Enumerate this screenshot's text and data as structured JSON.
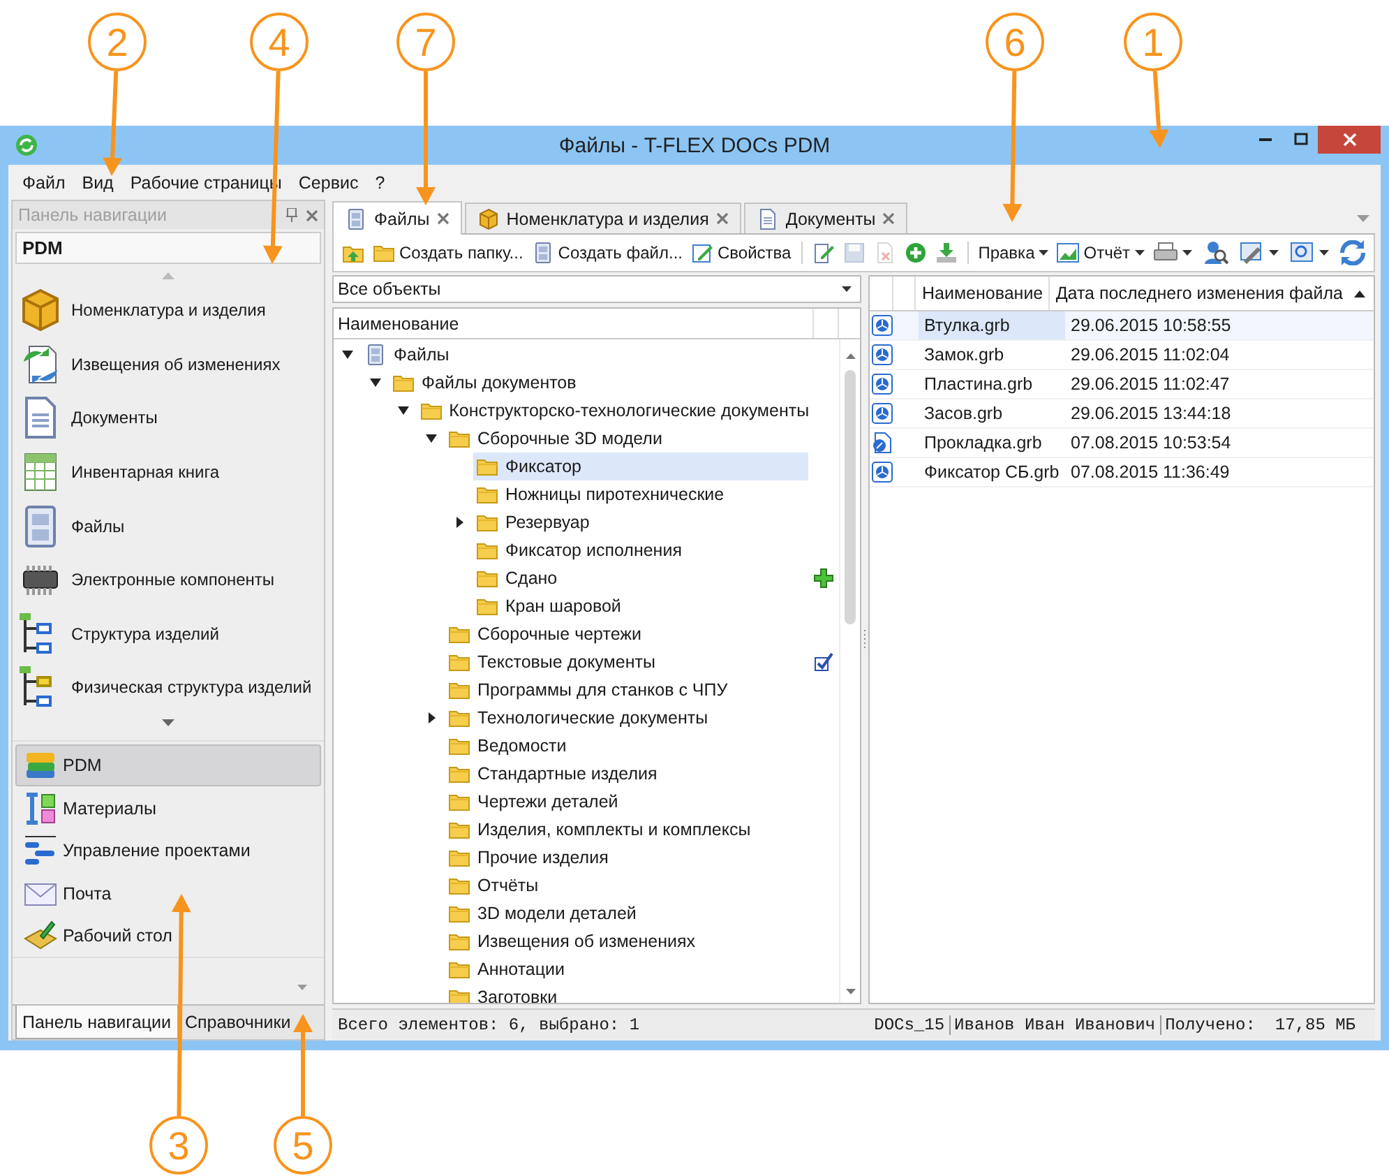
{
  "callouts": [
    {
      "number": "2"
    },
    {
      "number": "4"
    },
    {
      "number": "7"
    },
    {
      "number": "6"
    },
    {
      "number": "1"
    },
    {
      "number": "3"
    },
    {
      "number": "5"
    }
  ],
  "window": {
    "title": "Файлы - T-FLEX DOCs PDM"
  },
  "menu": [
    "Файл",
    "Вид",
    "Рабочие страницы",
    "Сервис",
    "?"
  ],
  "nav_panel": {
    "title": "Панель навигации",
    "section": "PDM",
    "items": [
      {
        "label": "Номенклатура и изделия"
      },
      {
        "label": "Извещения об изменениях"
      },
      {
        "label": "Документы"
      },
      {
        "label": "Инвентарная книга"
      },
      {
        "label": "Файлы"
      },
      {
        "label": "Электронные компоненты"
      },
      {
        "label": "Структура изделий"
      },
      {
        "label": "Физическая структура изделий"
      }
    ],
    "groups": [
      {
        "label": "PDM",
        "selected": true
      },
      {
        "label": "Материалы",
        "selected": false
      },
      {
        "label": "Управление проектами",
        "selected": false
      },
      {
        "label": "Почта",
        "selected": false
      },
      {
        "label": "Рабочий стол",
        "selected": false
      }
    ],
    "bottom_tabs": [
      {
        "label": "Панель навигации",
        "selected": true
      },
      {
        "label": "Справочники",
        "selected": false
      }
    ]
  },
  "tabs": [
    {
      "label": "Файлы",
      "selected": true
    },
    {
      "label": "Номенклатура и изделия",
      "selected": false
    },
    {
      "label": "Документы",
      "selected": false
    }
  ],
  "toolbar": {
    "left": [
      {
        "kind": "icon",
        "disabled": false
      },
      {
        "kind": "button",
        "label": "Создать папку..."
      },
      {
        "kind": "button",
        "label": "Создать файл..."
      },
      {
        "kind": "button",
        "label": "Свойства"
      },
      {
        "kind": "separator"
      },
      {
        "kind": "icon",
        "disabled": false
      },
      {
        "kind": "icon",
        "disabled": true
      },
      {
        "kind": "icon",
        "disabled": true
      },
      {
        "kind": "icon",
        "disabled": false
      },
      {
        "kind": "icon",
        "disabled": false
      },
      {
        "kind": "separator"
      },
      {
        "kind": "menu",
        "label": "Правка"
      },
      {
        "kind": "menu",
        "label": "Отчёт"
      }
    ],
    "right": [
      {
        "kind": "icon-menu"
      },
      {
        "kind": "icon"
      },
      {
        "kind": "icon-menu"
      },
      {
        "kind": "icon-menu"
      },
      {
        "kind": "icon"
      }
    ]
  },
  "filter": {
    "value": "Все объекты"
  },
  "tree": {
    "column": "Наименование",
    "items": [
      {
        "label": "Файлы",
        "expanded": true,
        "selected": false,
        "children": [
          {
            "label": "Файлы документов",
            "expanded": true,
            "selected": false,
            "children": [
              {
                "label": "Конструкторско-технологические документы",
                "expanded": true,
                "selected": false,
                "children": [
                  {
                    "label": "Сборочные 3D модели",
                    "expanded": true,
                    "selected": false,
                    "children": [
                      {
                        "label": "Фиксатор",
                        "selected": true
                      },
                      {
                        "label": "Ножницы пиротехнические",
                        "selected": false
                      },
                      {
                        "label": "Резервуар",
                        "expanded": false,
                        "selected": false
                      },
                      {
                        "label": "Фиксатор исполнения",
                        "selected": false
                      },
                      {
                        "label": "Сдано",
                        "selected": false,
                        "added": true
                      },
                      {
                        "label": "Кран шаровой",
                        "selected": false
                      }
                    ]
                  },
                  {
                    "label": "Сборочные чертежи",
                    "selected": false
                  },
                  {
                    "label": "Текстовые документы",
                    "selected": false,
                    "checked": true
                  },
                  {
                    "label": "Программы для станков с ЧПУ",
                    "selected": false
                  },
                  {
                    "label": "Технологические документы",
                    "expanded": false,
                    "selected": false
                  },
                  {
                    "label": "Ведомости",
                    "selected": false
                  },
                  {
                    "label": "Стандартные изделия",
                    "selected": false
                  },
                  {
                    "label": "Чертежи деталей",
                    "selected": false
                  },
                  {
                    "label": "Изделия, комплекты и комплексы",
                    "selected": false
                  },
                  {
                    "label": "Прочие изделия",
                    "selected": false
                  },
                  {
                    "label": "Отчёты",
                    "selected": false
                  },
                  {
                    "label": "3D модели деталей",
                    "selected": false
                  },
                  {
                    "label": "Извещения об изменениях",
                    "selected": false
                  },
                  {
                    "label": "Аннотации",
                    "selected": false
                  },
                  {
                    "label": "Заготовки",
                    "selected": false
                  }
                ]
              }
            ]
          }
        ]
      }
    ]
  },
  "files": {
    "columns": [
      {
        "label": "Наименование",
        "sorted": false
      },
      {
        "label": "Дата последнего изменения файла",
        "sorted": true
      }
    ],
    "rows": [
      {
        "kind": "model",
        "name": "Втулка.grb",
        "date": "29.06.2015 10:58:55",
        "selected": true
      },
      {
        "kind": "model",
        "name": "Замок.grb",
        "date": "29.06.2015 11:02:04",
        "selected": false
      },
      {
        "kind": "model",
        "name": "Пластина.grb",
        "date": "29.06.2015 11:02:47",
        "selected": false
      },
      {
        "kind": "model",
        "name": "Засов.grb",
        "date": "29.06.2015 13:44:18",
        "selected": false
      },
      {
        "kind": "drawing",
        "name": "Прокладка.grb",
        "date": "07.08.2015 10:53:54",
        "selected": false
      },
      {
        "kind": "model",
        "name": "Фиксатор СБ.grb",
        "date": "07.08.2015 11:36:49",
        "selected": false
      }
    ]
  },
  "status_bar": {
    "summary": "Всего элементов: 6, выбрано: 1",
    "database": "DOCs_15",
    "user": "Иванов Иван Иванович",
    "received_label": "Получено:",
    "received_value": "17,85 МБ"
  }
}
